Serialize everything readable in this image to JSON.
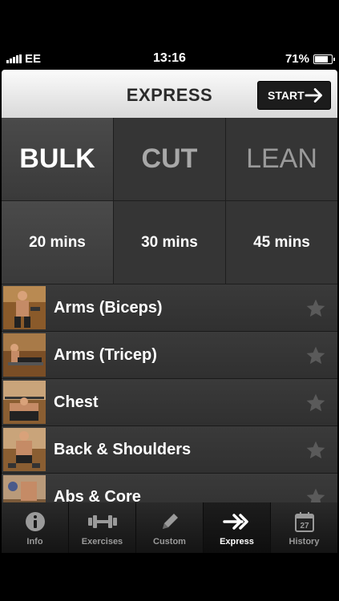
{
  "status_bar": {
    "carrier": "EE",
    "time": "13:16",
    "battery": "71%"
  },
  "navbar": {
    "title": "EXPRESS",
    "start_label": "START"
  },
  "workout_types": [
    {
      "label": "BULK",
      "selected": true,
      "color": "#ffffff"
    },
    {
      "label": "CUT",
      "selected": false,
      "color": "#a8a8a8"
    },
    {
      "label": "LEAN",
      "selected": false,
      "color": "#9a9a9a"
    }
  ],
  "durations": [
    {
      "label": "20 mins",
      "selected": true
    },
    {
      "label": "30 mins",
      "selected": false
    },
    {
      "label": "45 mins",
      "selected": false
    }
  ],
  "exercises": [
    {
      "label": "Arms (Biceps)",
      "icon": "star-icon"
    },
    {
      "label": "Arms (Tricep)",
      "icon": "star-icon"
    },
    {
      "label": "Chest",
      "icon": "star-icon"
    },
    {
      "label": "Back & Shoulders",
      "icon": "star-icon"
    },
    {
      "label": "Abs & Core",
      "icon": "star-icon"
    }
  ],
  "tabs": [
    {
      "label": "Info",
      "icon": "info-icon",
      "active": false
    },
    {
      "label": "Exercises",
      "icon": "dumbbell-icon",
      "active": false
    },
    {
      "label": "Custom",
      "icon": "pencil-icon",
      "active": false
    },
    {
      "label": "Express",
      "icon": "double-arrow-icon",
      "active": true
    },
    {
      "label": "History",
      "icon": "calendar-icon",
      "active": false,
      "badge": "27"
    }
  ],
  "colors": {
    "accent": "#ffffff",
    "background": "#333333",
    "navbar": "#e6e6e6"
  }
}
